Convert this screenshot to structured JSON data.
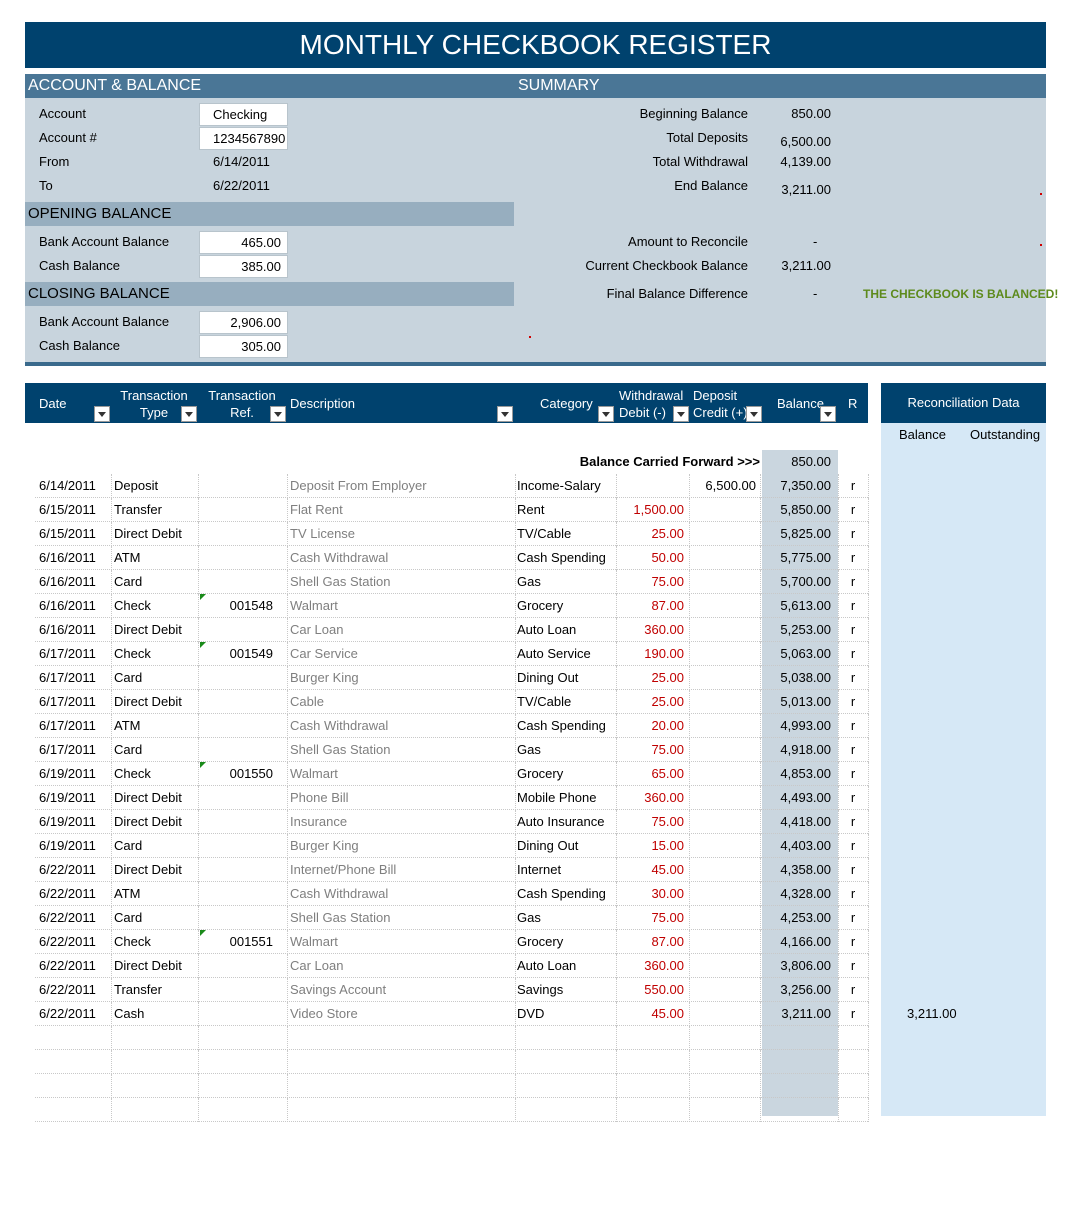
{
  "title": "MONTHLY CHECKBOOK REGISTER",
  "account_section": {
    "header": "ACCOUNT & BALANCE",
    "account_label": "Account",
    "account_value": "Checking",
    "account_num_label": "Account #",
    "account_num_value": "1234567890",
    "from_label": "From",
    "from_value": "6/14/2011",
    "to_label": "To",
    "to_value": "6/22/2011"
  },
  "opening": {
    "header": "OPENING BALANCE",
    "bank_label": "Bank Account Balance",
    "bank_value": "465.00",
    "cash_label": "Cash Balance",
    "cash_value": "385.00"
  },
  "closing": {
    "header": "CLOSING BALANCE",
    "bank_label": "Bank Account Balance",
    "bank_value": "2,906.00",
    "cash_label": "Cash Balance",
    "cash_value": "305.00"
  },
  "summary": {
    "header": "SUMMARY",
    "beginning_label": "Beginning Balance",
    "beginning_value": "850.00",
    "deposits_label": "Total Deposits",
    "deposits_value": "6,500.00",
    "withdrawal_label": "Total Withdrawal",
    "withdrawal_value": "4,139.00",
    "end_label": "End Balance",
    "end_value": "3,211.00",
    "reconcile_label": "Amount to Reconcile",
    "reconcile_value": "-",
    "current_label": "Current Checkbook Balance",
    "current_value": "3,211.00",
    "diff_label": "Final Balance Difference",
    "diff_value": "-",
    "status": "THE CHECKBOOK IS BALANCED!"
  },
  "columns": {
    "date": "Date",
    "type_line1": "Transaction",
    "type_line2": "Type",
    "ref_line1": "Transaction",
    "ref_line2": "Ref.",
    "description": "Description",
    "category": "Category",
    "wd_line1": "Withdrawal",
    "wd_line2": "Debit (-)",
    "dep_line1": "Deposit",
    "dep_line2": "Credit (+)",
    "balance": "Balance",
    "r": "R"
  },
  "reconciliation": {
    "header": "Reconciliation Data",
    "balance_label": "Balance",
    "outstanding_label": "Outstanding",
    "final_balance": "3,211.00"
  },
  "carried_forward": {
    "label": "Balance Carried Forward >>>",
    "value": "850.00"
  },
  "transactions": [
    {
      "date": "6/14/2011",
      "type": "Deposit",
      "ref": "",
      "desc": "Deposit From Employer",
      "cat": "Income-Salary",
      "wd": "",
      "dep": "6,500.00",
      "bal": "7,350.00",
      "r": "r",
      "flag": false
    },
    {
      "date": "6/15/2011",
      "type": "Transfer",
      "ref": "",
      "desc": "Flat Rent",
      "cat": "Rent",
      "wd": "1,500.00",
      "dep": "",
      "bal": "5,850.00",
      "r": "r",
      "flag": false
    },
    {
      "date": "6/15/2011",
      "type": "Direct Debit",
      "ref": "",
      "desc": "TV License",
      "cat": "TV/Cable",
      "wd": "25.00",
      "dep": "",
      "bal": "5,825.00",
      "r": "r",
      "flag": false
    },
    {
      "date": "6/16/2011",
      "type": "ATM",
      "ref": "",
      "desc": "Cash Withdrawal",
      "cat": "Cash Spending",
      "wd": "50.00",
      "dep": "",
      "bal": "5,775.00",
      "r": "r",
      "flag": false
    },
    {
      "date": "6/16/2011",
      "type": "Card",
      "ref": "",
      "desc": "Shell Gas Station",
      "cat": "Gas",
      "wd": "75.00",
      "dep": "",
      "bal": "5,700.00",
      "r": "r",
      "flag": false
    },
    {
      "date": "6/16/2011",
      "type": "Check",
      "ref": "001548",
      "desc": "Walmart",
      "cat": "Grocery",
      "wd": "87.00",
      "dep": "",
      "bal": "5,613.00",
      "r": "r",
      "flag": true
    },
    {
      "date": "6/16/2011",
      "type": "Direct Debit",
      "ref": "",
      "desc": "Car Loan",
      "cat": "Auto Loan",
      "wd": "360.00",
      "dep": "",
      "bal": "5,253.00",
      "r": "r",
      "flag": false
    },
    {
      "date": "6/17/2011",
      "type": "Check",
      "ref": "001549",
      "desc": "Car Service",
      "cat": "Auto Service",
      "wd": "190.00",
      "dep": "",
      "bal": "5,063.00",
      "r": "r",
      "flag": true
    },
    {
      "date": "6/17/2011",
      "type": "Card",
      "ref": "",
      "desc": "Burger King",
      "cat": "Dining Out",
      "wd": "25.00",
      "dep": "",
      "bal": "5,038.00",
      "r": "r",
      "flag": false
    },
    {
      "date": "6/17/2011",
      "type": "Direct Debit",
      "ref": "",
      "desc": "Cable",
      "cat": "TV/Cable",
      "wd": "25.00",
      "dep": "",
      "bal": "5,013.00",
      "r": "r",
      "flag": false
    },
    {
      "date": "6/17/2011",
      "type": "ATM",
      "ref": "",
      "desc": "Cash Withdrawal",
      "cat": "Cash Spending",
      "wd": "20.00",
      "dep": "",
      "bal": "4,993.00",
      "r": "r",
      "flag": false
    },
    {
      "date": "6/17/2011",
      "type": "Card",
      "ref": "",
      "desc": "Shell Gas Station",
      "cat": "Gas",
      "wd": "75.00",
      "dep": "",
      "bal": "4,918.00",
      "r": "r",
      "flag": false
    },
    {
      "date": "6/19/2011",
      "type": "Check",
      "ref": "001550",
      "desc": "Walmart",
      "cat": "Grocery",
      "wd": "65.00",
      "dep": "",
      "bal": "4,853.00",
      "r": "r",
      "flag": true
    },
    {
      "date": "6/19/2011",
      "type": "Direct Debit",
      "ref": "",
      "desc": "Phone Bill",
      "cat": "Mobile Phone",
      "wd": "360.00",
      "dep": "",
      "bal": "4,493.00",
      "r": "r",
      "flag": false
    },
    {
      "date": "6/19/2011",
      "type": "Direct Debit",
      "ref": "",
      "desc": "Insurance",
      "cat": "Auto Insurance",
      "wd": "75.00",
      "dep": "",
      "bal": "4,418.00",
      "r": "r",
      "flag": false
    },
    {
      "date": "6/19/2011",
      "type": "Card",
      "ref": "",
      "desc": "Burger King",
      "cat": "Dining Out",
      "wd": "15.00",
      "dep": "",
      "bal": "4,403.00",
      "r": "r",
      "flag": false
    },
    {
      "date": "6/22/2011",
      "type": "Direct Debit",
      "ref": "",
      "desc": "Internet/Phone Bill",
      "cat": "Internet",
      "wd": "45.00",
      "dep": "",
      "bal": "4,358.00",
      "r": "r",
      "flag": false
    },
    {
      "date": "6/22/2011",
      "type": "ATM",
      "ref": "",
      "desc": "Cash Withdrawal",
      "cat": "Cash Spending",
      "wd": "30.00",
      "dep": "",
      "bal": "4,328.00",
      "r": "r",
      "flag": false
    },
    {
      "date": "6/22/2011",
      "type": "Card",
      "ref": "",
      "desc": "Shell Gas Station",
      "cat": "Gas",
      "wd": "75.00",
      "dep": "",
      "bal": "4,253.00",
      "r": "r",
      "flag": false
    },
    {
      "date": "6/22/2011",
      "type": "Check",
      "ref": "001551",
      "desc": "Walmart",
      "cat": "Grocery",
      "wd": "87.00",
      "dep": "",
      "bal": "4,166.00",
      "r": "r",
      "flag": true
    },
    {
      "date": "6/22/2011",
      "type": "Direct Debit",
      "ref": "",
      "desc": "Car Loan",
      "cat": "Auto Loan",
      "wd": "360.00",
      "dep": "",
      "bal": "3,806.00",
      "r": "r",
      "flag": false
    },
    {
      "date": "6/22/2011",
      "type": "Transfer",
      "ref": "",
      "desc": "Savings Account",
      "cat": "Savings",
      "wd": "550.00",
      "dep": "",
      "bal": "3,256.00",
      "r": "r",
      "flag": false
    },
    {
      "date": "6/22/2011",
      "type": "Cash",
      "ref": "",
      "desc": "Video Store",
      "cat": "DVD",
      "wd": "45.00",
      "dep": "",
      "bal": "3,211.00",
      "r": "r",
      "flag": false
    },
    {
      "date": "",
      "type": "",
      "ref": "",
      "desc": "",
      "cat": "",
      "wd": "",
      "dep": "",
      "bal": "",
      "r": "",
      "flag": false
    },
    {
      "date": "",
      "type": "",
      "ref": "",
      "desc": "",
      "cat": "",
      "wd": "",
      "dep": "",
      "bal": "",
      "r": "",
      "flag": false
    },
    {
      "date": "",
      "type": "",
      "ref": "",
      "desc": "",
      "cat": "",
      "wd": "",
      "dep": "",
      "bal": "",
      "r": "",
      "flag": false
    },
    {
      "date": "",
      "type": "",
      "ref": "",
      "desc": "",
      "cat": "",
      "wd": "",
      "dep": "",
      "bal": "",
      "r": "",
      "flag": false
    }
  ]
}
